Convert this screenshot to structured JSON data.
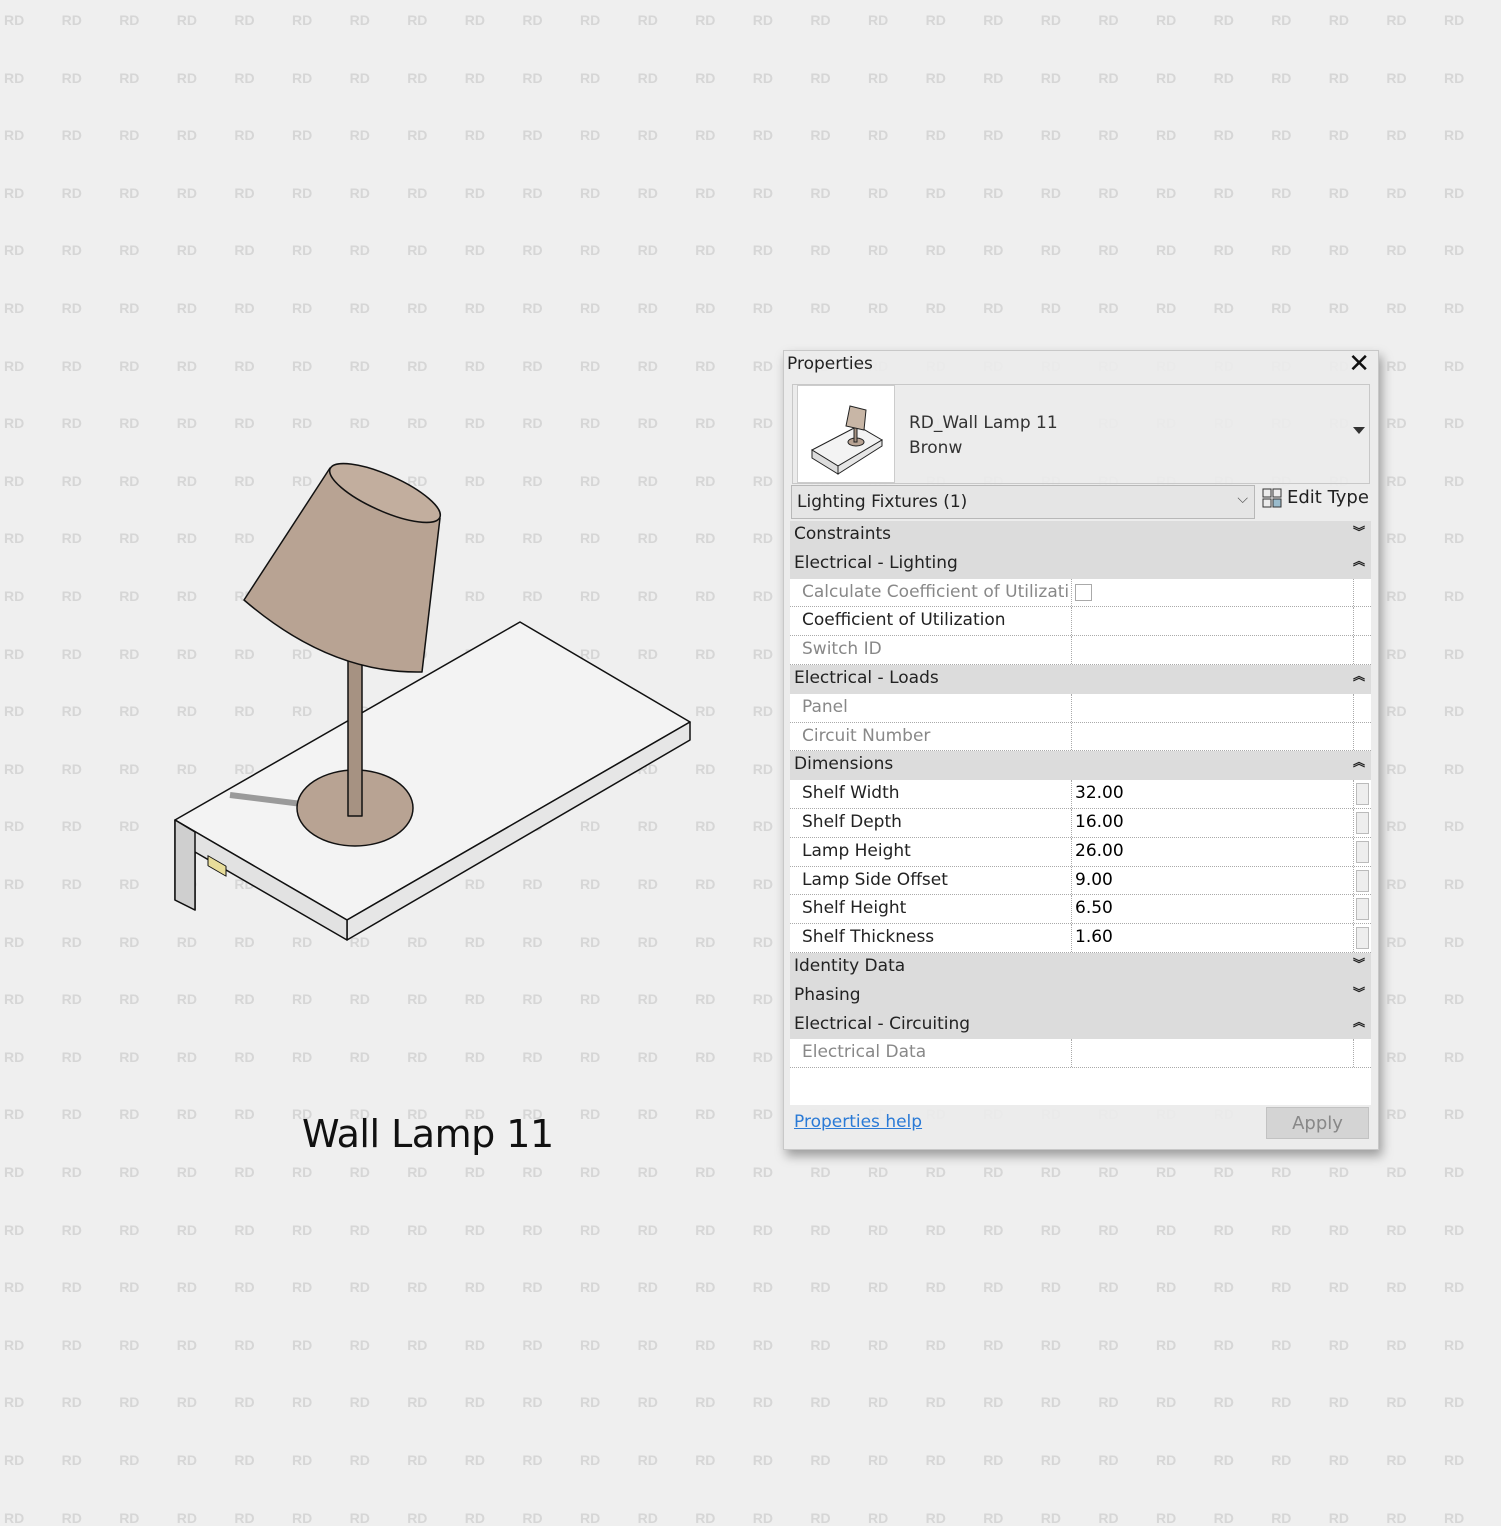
{
  "watermark": "RD",
  "caption": "Wall Lamp 11",
  "colors": {
    "shade": "#b8a393",
    "accent_link": "#2a7ad6",
    "category_bg": "#dcdcdc"
  },
  "panel": {
    "title": "Properties",
    "close_icon": "close-icon",
    "type_name": "RD_Wall Lamp 11",
    "type_variant": "Bronw",
    "filter": "Lighting Fixtures (1)",
    "edit_type": "Edit Type",
    "help": "Properties help",
    "apply": "Apply",
    "groups": [
      {
        "name": "Constraints",
        "expanded": false,
        "rows": []
      },
      {
        "name": "Electrical - Lighting",
        "expanded": true,
        "rows": [
          {
            "label": "Calculate Coefficient of Utilizati...",
            "value": "",
            "checkbox": true,
            "enabled": false
          },
          {
            "label": "Coefficient of Utilization",
            "value": "",
            "enabled": true
          },
          {
            "label": "Switch ID",
            "value": "",
            "enabled": false
          }
        ]
      },
      {
        "name": "Electrical - Loads",
        "expanded": true,
        "rows": [
          {
            "label": "Panel",
            "value": "",
            "enabled": false
          },
          {
            "label": "Circuit Number",
            "value": "",
            "enabled": false
          }
        ]
      },
      {
        "name": "Dimensions",
        "expanded": true,
        "rows": [
          {
            "label": "Shelf Width",
            "value": "32.00",
            "enabled": true,
            "button": true
          },
          {
            "label": "Shelf Depth",
            "value": "16.00",
            "enabled": true,
            "button": true
          },
          {
            "label": "Lamp Height",
            "value": "26.00",
            "enabled": true,
            "button": true
          },
          {
            "label": "Lamp Side Offset",
            "value": "9.00",
            "enabled": true,
            "button": true
          },
          {
            "label": "Shelf Height",
            "value": "6.50",
            "enabled": true,
            "button": true
          },
          {
            "label": "Shelf Thickness",
            "value": "1.60",
            "enabled": true,
            "button": true
          }
        ]
      },
      {
        "name": "Identity Data",
        "expanded": false,
        "rows": []
      },
      {
        "name": "Phasing",
        "expanded": false,
        "rows": []
      },
      {
        "name": "Electrical - Circuiting",
        "expanded": true,
        "rows": [
          {
            "label": "Electrical Data",
            "value": "",
            "enabled": false
          }
        ]
      }
    ]
  }
}
